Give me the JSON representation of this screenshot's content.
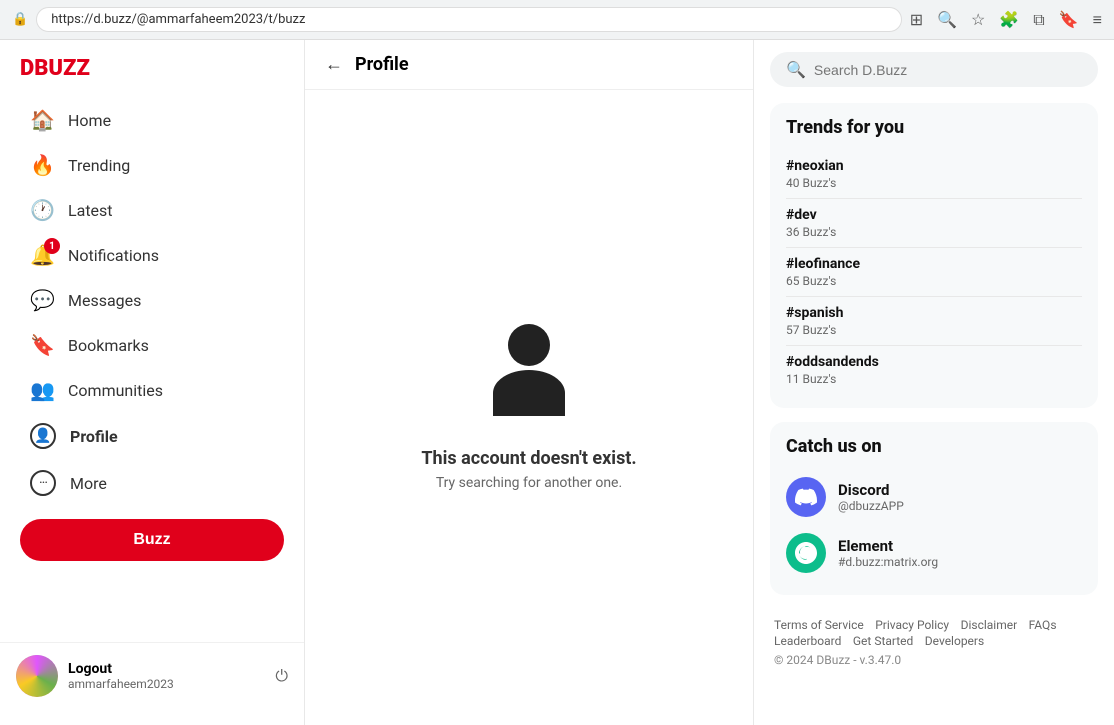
{
  "browser": {
    "url": "https://d.buzz/@ammarfaheem2023/t/buzz"
  },
  "logo": {
    "prefix": "D",
    "suffix": "BUZZ"
  },
  "nav": {
    "items": [
      {
        "id": "home",
        "label": "Home",
        "icon": "🏠"
      },
      {
        "id": "trending",
        "label": "Trending",
        "icon": "🔥"
      },
      {
        "id": "latest",
        "label": "Latest",
        "icon": "🕐"
      },
      {
        "id": "notifications",
        "label": "Notifications",
        "icon": "🔔",
        "badge": "1"
      },
      {
        "id": "messages",
        "label": "Messages",
        "icon": "💬"
      },
      {
        "id": "bookmarks",
        "label": "Bookmarks",
        "icon": "🔖"
      },
      {
        "id": "communities",
        "label": "Communities",
        "icon": "👥"
      },
      {
        "id": "profile",
        "label": "Profile",
        "icon": "👤",
        "active": true
      },
      {
        "id": "more",
        "label": "More",
        "icon": "⋯"
      }
    ],
    "buzz_button": "Buzz"
  },
  "user": {
    "name": "Logout",
    "handle": "ammarfaheem2023"
  },
  "profile_page": {
    "header": "Profile",
    "back_label": "←",
    "not_found_title": "This account doesn't exist.",
    "not_found_sub": "Try searching for another one."
  },
  "search": {
    "placeholder": "Search D.Buzz"
  },
  "trends": {
    "heading": "Trends for you",
    "items": [
      {
        "tag": "#neoxian",
        "count": "40 Buzz's"
      },
      {
        "tag": "#dev",
        "count": "36 Buzz's"
      },
      {
        "tag": "#leofinance",
        "count": "65 Buzz's"
      },
      {
        "tag": "#spanish",
        "count": "57 Buzz's"
      },
      {
        "tag": "#oddsandends",
        "count": "11 Buzz's"
      }
    ]
  },
  "catch_us": {
    "heading": "Catch us on",
    "items": [
      {
        "name": "Discord",
        "handle": "@dbuzzAPP",
        "icon": "discord"
      },
      {
        "name": "Element",
        "handle": "#d.buzz:matrix.org",
        "icon": "element"
      }
    ]
  },
  "footer": {
    "links": [
      "Terms of Service",
      "Privacy Policy",
      "Disclaimer",
      "FAQs",
      "Leaderboard",
      "Get Started",
      "Developers"
    ],
    "copyright": "© 2024 DBuzz  -  v.3.47.0"
  }
}
